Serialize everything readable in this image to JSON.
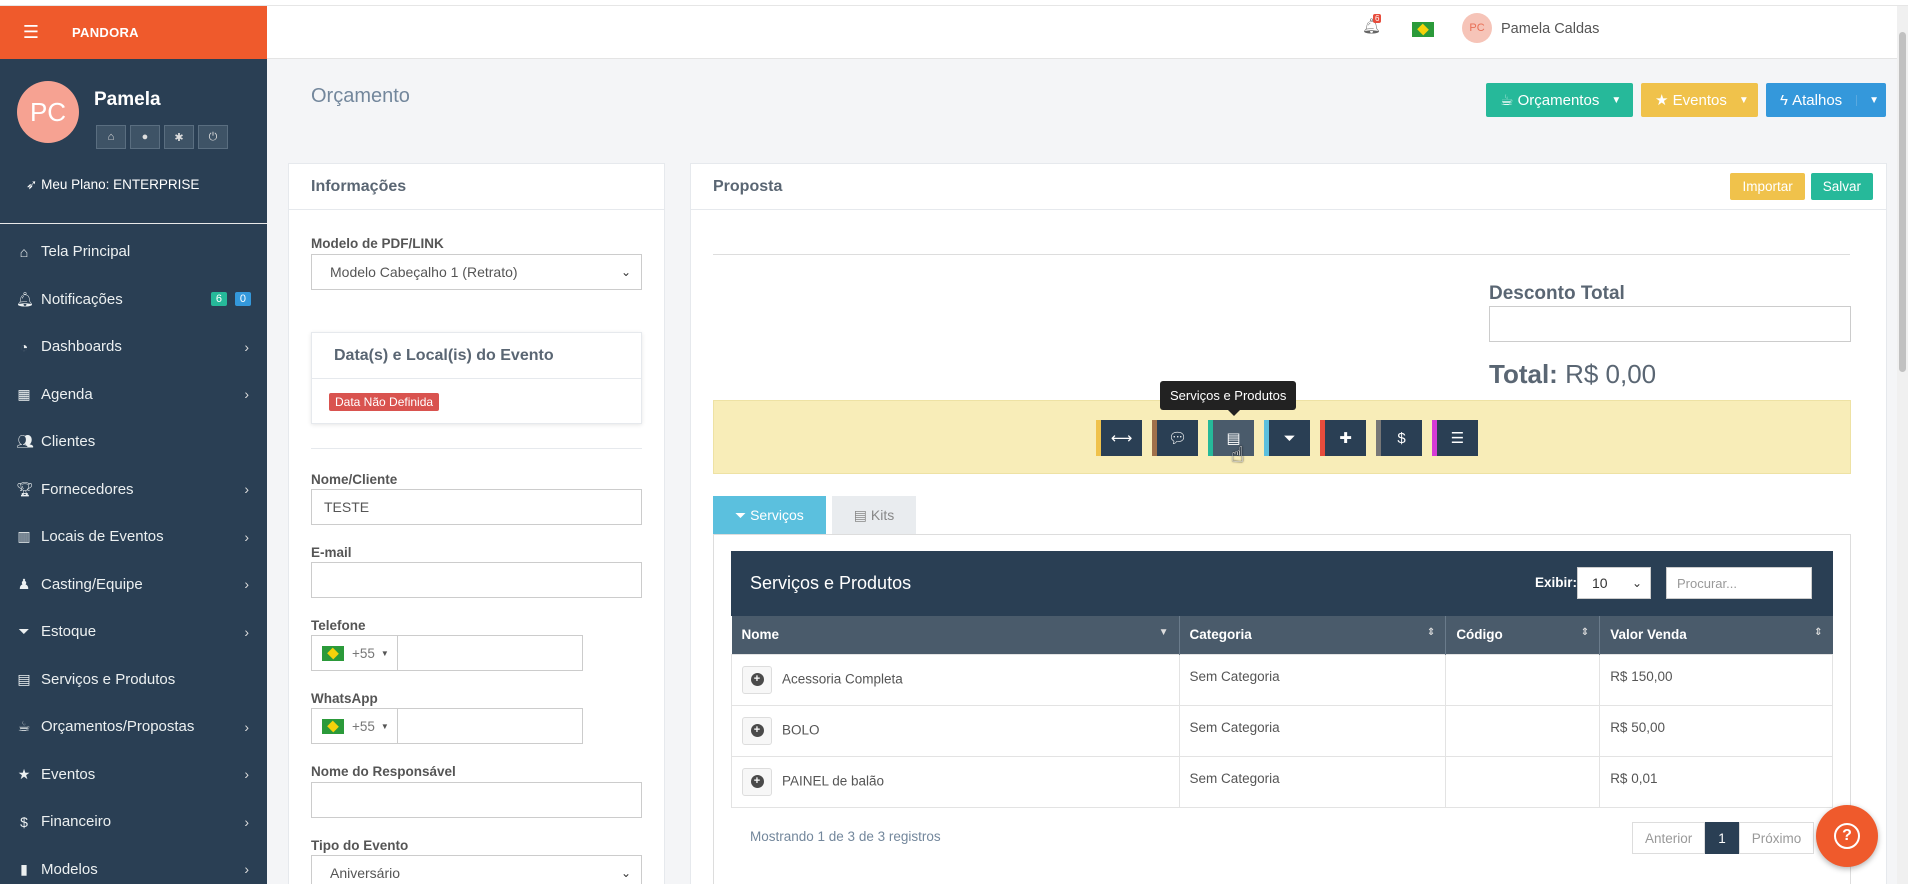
{
  "brand": {
    "name": "PANDORA"
  },
  "profile": {
    "initials": "PC",
    "name": "Pamela",
    "plan": "Meu Plano: ENTERPRISE"
  },
  "nav": {
    "items": [
      {
        "label": "Tela Principal",
        "icon": "home-icon"
      },
      {
        "label": "Notificações",
        "icon": "bell-icon",
        "badge1": "6",
        "badge2": "0"
      },
      {
        "label": "Dashboards",
        "icon": "dashboard-icon"
      },
      {
        "label": "Agenda",
        "icon": "calendar-icon"
      },
      {
        "label": "Clientes",
        "icon": "users-icon"
      },
      {
        "label": "Fornecedores",
        "icon": "trophy-icon"
      },
      {
        "label": "Locais de Eventos",
        "icon": "building-icon"
      },
      {
        "label": "Casting/Equipe",
        "icon": "person-icon"
      },
      {
        "label": "Estoque",
        "icon": "filter-icon"
      },
      {
        "label": "Serviços e Produtos",
        "icon": "archive-icon"
      },
      {
        "label": "Orçamentos/Propostas",
        "icon": "coffee-icon"
      },
      {
        "label": "Eventos",
        "icon": "star-icon"
      },
      {
        "label": "Financeiro",
        "icon": "dollar-icon"
      },
      {
        "label": "Modelos",
        "icon": "book-icon"
      }
    ]
  },
  "header": {
    "notification_count": "6",
    "user_initials": "PC",
    "user_name": "Pamela Caldas"
  },
  "page": {
    "title": "Orçamento",
    "buttons": {
      "orcamentos": "Orçamentos",
      "eventos": "Eventos",
      "atalhos": "Atalhos"
    }
  },
  "info": {
    "title": "Informações",
    "pdf_label": "Modelo de PDF/LINK",
    "pdf_value": "Modelo Cabeçalho 1 (Retrato)",
    "event_box_title": "Data(s) e Local(is) do Evento",
    "event_badge": "Data Não Definida",
    "client_label": "Nome/Cliente",
    "client_value": "TESTE",
    "email_label": "E-mail",
    "phone_label": "Telefone",
    "phone_code": "+55",
    "whatsapp_label": "WhatsApp",
    "whatsapp_code": "+55",
    "responsible_label": "Nome do Responsável",
    "event_type_label": "Tipo do Evento",
    "event_type_value": "Aniversário"
  },
  "proposal": {
    "title": "Proposta",
    "import_label": "Importar",
    "save_label": "Salvar",
    "discount_label": "Desconto Total",
    "total_label": "Total:",
    "total_value": "R$ 0,00",
    "tooltip": "Serviços e Produtos",
    "tab_services": "Serviços",
    "tab_kits": "Kits"
  },
  "table": {
    "title": "Serviços e Produtos",
    "show_label": "Exibir:",
    "page_length": "10",
    "search_placeholder": "Procurar...",
    "columns": [
      "Nome",
      "Categoria",
      "Código",
      "Valor Venda"
    ],
    "rows": [
      {
        "name": "Acessoria Completa",
        "category": "Sem Categoria",
        "code": "",
        "price": "R$ 150,00"
      },
      {
        "name": "BOLO",
        "category": "Sem Categoria",
        "code": "",
        "price": "R$ 50,00"
      },
      {
        "name": "PAINEL de balão",
        "category": "Sem Categoria",
        "code": "",
        "price": "R$ 0,01"
      }
    ],
    "info": "Mostrando 1 de 3 de 3 registros",
    "prev": "Anterior",
    "current_page": "1",
    "next": "Próximo"
  },
  "colors": {
    "sidebar": "#2a3f54",
    "brand": "#ef5a2c",
    "green": "#26b99a",
    "yellow": "#f0c24b",
    "blue": "#3498db"
  }
}
